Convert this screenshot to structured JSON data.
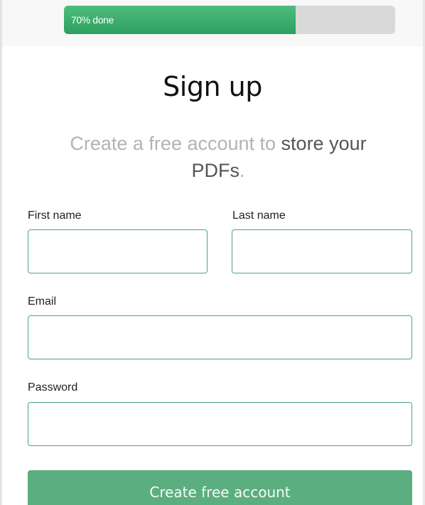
{
  "progress": {
    "label": "70% done",
    "fraction": 0.7,
    "fill_color": "#3db06f",
    "track_color": "#d9d9d9"
  },
  "title": "Sign up",
  "subtitle": {
    "part1": "Create a free account to ",
    "emphasis1": "store your PDFs",
    "part2": "."
  },
  "form": {
    "first_name": {
      "label": "First name",
      "value": ""
    },
    "last_name": {
      "label": "Last name",
      "value": ""
    },
    "email": {
      "label": "Email",
      "value": ""
    },
    "password": {
      "label": "Password",
      "value": ""
    },
    "submit_label": "Create free account"
  },
  "colors": {
    "accent": "#5bae7f",
    "input_border": "#4aa57a"
  }
}
